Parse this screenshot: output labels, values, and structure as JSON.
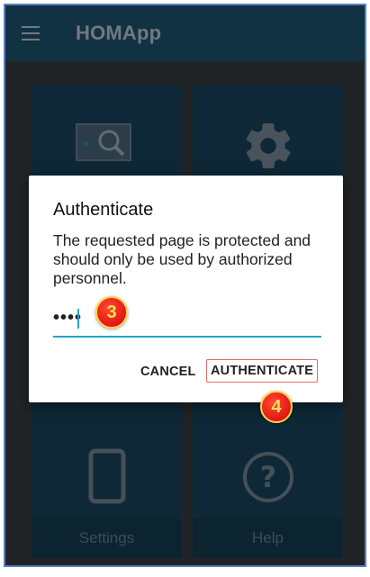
{
  "app": {
    "title": "HOMApp"
  },
  "tiles": [
    {
      "id": "monitor",
      "icon": "monitor-search-icon",
      "label": ""
    },
    {
      "id": "config",
      "icon": "gear-icon",
      "label": ""
    },
    {
      "id": "settings",
      "icon": "phone-icon",
      "label": "Settings"
    },
    {
      "id": "help",
      "icon": "help-icon",
      "label": "Help"
    }
  ],
  "dialog": {
    "title": "Authenticate",
    "message": "The requested page is protected and should only be used by authorized personnel.",
    "password_value": "••••",
    "cancel_label": "CANCEL",
    "authenticate_label": "AUTHENTICATE"
  },
  "annotations": {
    "step_password": "3",
    "step_authenticate": "4"
  },
  "colors": {
    "appbar": "#1f5b79",
    "tile": "#1a4a66",
    "accent": "#26a6c9",
    "highlight": "#e06b6b",
    "badge": "#d4000b"
  }
}
